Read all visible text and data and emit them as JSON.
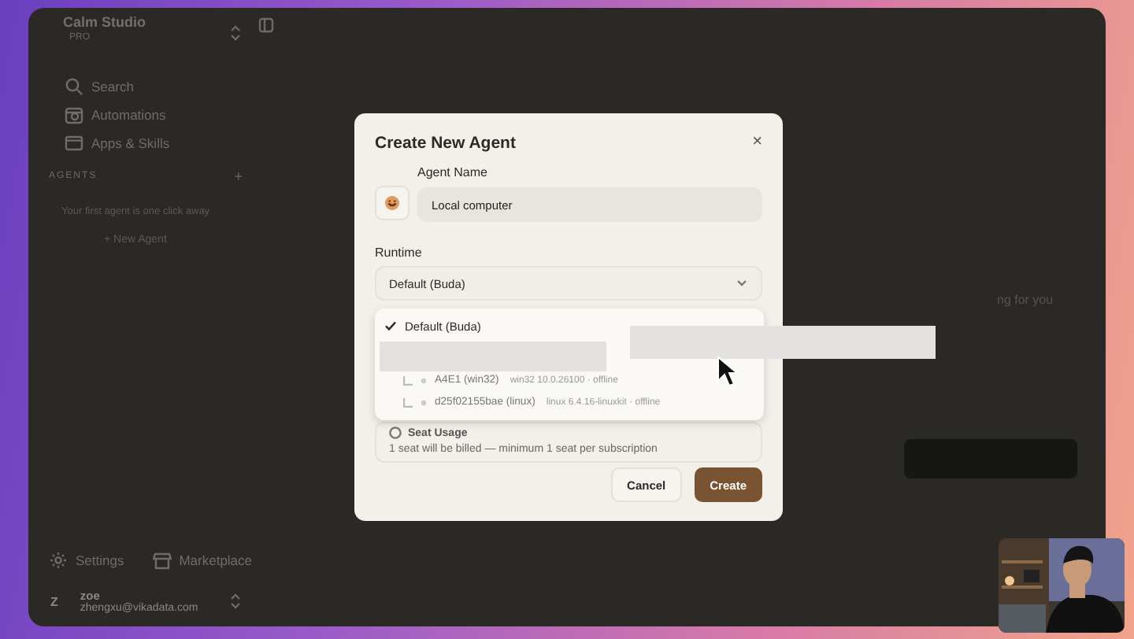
{
  "app": {
    "name": "Calm Studio",
    "plan": "PRO"
  },
  "sidebar": {
    "nav": [
      {
        "label": "Search"
      },
      {
        "label": "Automations"
      },
      {
        "label": "Apps & Skills"
      }
    ],
    "section": "AGENTS",
    "add": "+",
    "empty": "Your first agent is one click away",
    "new_agent": "+ New Agent",
    "footer": [
      {
        "label": "Settings"
      },
      {
        "label": "Marketplace"
      }
    ],
    "user": {
      "initial": "Z",
      "name": "zoe",
      "email": "zhengxu@vikadata.com"
    }
  },
  "main": {
    "partial_text": "ng for you"
  },
  "dialog": {
    "title": "Create New Agent",
    "close": "×",
    "name_label": "Agent Name",
    "name_value": "Local computer",
    "runtime_label": "Runtime",
    "runtime_value": "Default (Buda)",
    "options": [
      {
        "label": "Default (Buda)",
        "kind": "default",
        "selected": true
      },
      {
        "label": "A4E1 (win32)",
        "detail": "win32 10.0.26100 · offline",
        "kind": "machine",
        "selected": false
      },
      {
        "label": "d25f02155bae (linux)",
        "detail": "linux 6.4.16-linuxkit · offline",
        "kind": "machine",
        "selected": false
      }
    ],
    "seat": {
      "title": "Seat Usage",
      "note": "1 seat will be billed — minimum 1 seat per subscription"
    },
    "buttons": [
      {
        "label": "Cancel",
        "kind": "secondary"
      },
      {
        "label": "Create",
        "kind": "primary"
      }
    ]
  }
}
